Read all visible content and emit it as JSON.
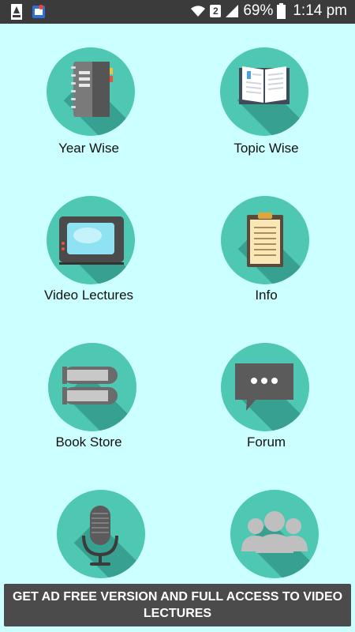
{
  "status_bar": {
    "signal_badge": "2",
    "battery": "69%",
    "time": "1:14 pm"
  },
  "menu": {
    "items": [
      {
        "label": "Year Wise",
        "icon": "notebook-icon"
      },
      {
        "label": "Topic Wise",
        "icon": "open-book-icon"
      },
      {
        "label": "Video Lectures",
        "icon": "tv-icon"
      },
      {
        "label": "Info",
        "icon": "clipboard-icon"
      },
      {
        "label": "Book Store",
        "icon": "books-icon"
      },
      {
        "label": "Forum",
        "icon": "chat-bubble-icon"
      },
      {
        "label": "",
        "icon": "microphone-icon"
      },
      {
        "label": "",
        "icon": "group-icon"
      }
    ]
  },
  "banner": {
    "text": "GET AD FREE VERSION AND FULL ACCESS TO VIDEO LECTURES"
  },
  "colors": {
    "background": "#ccffff",
    "circle": "#4ec7b3",
    "status_bar": "#3b3b3b",
    "banner": "#4b4b4b"
  }
}
